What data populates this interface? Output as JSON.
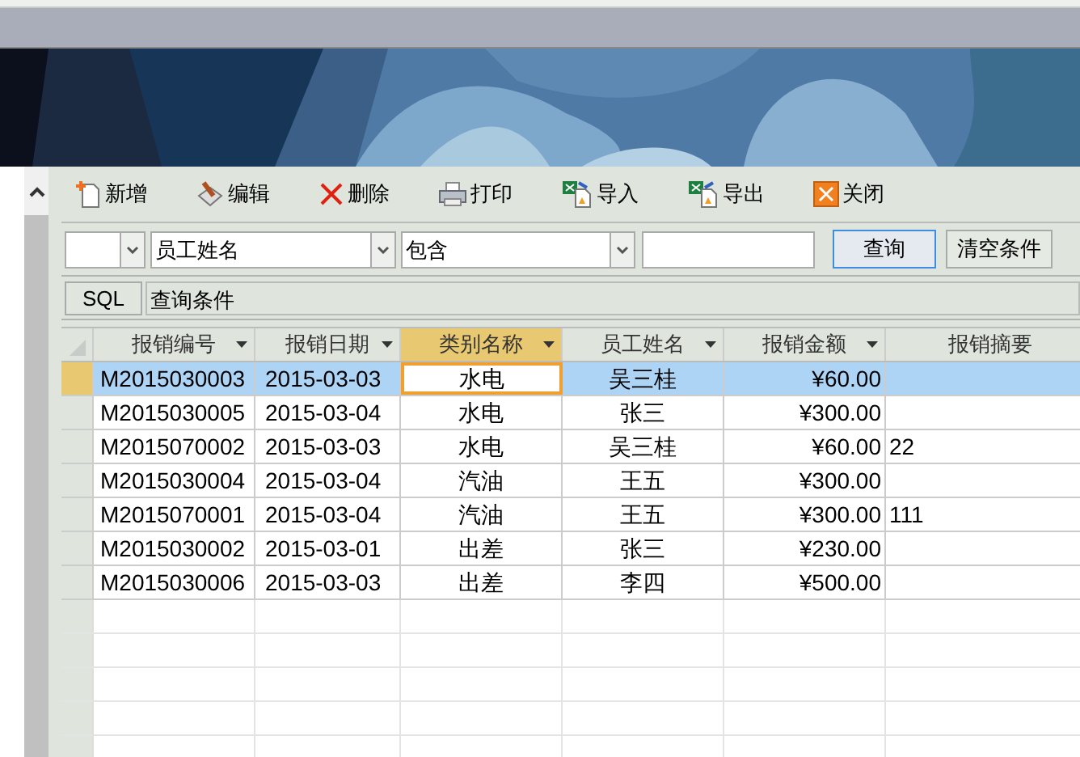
{
  "toolbar": [
    {
      "label": "新增",
      "kind": "add"
    },
    {
      "label": "编辑",
      "kind": "edit"
    },
    {
      "label": "删除",
      "kind": "delete"
    },
    {
      "label": "打印",
      "kind": "print"
    },
    {
      "label": "导入",
      "kind": "import"
    },
    {
      "label": "导出",
      "kind": "export"
    },
    {
      "label": "关闭",
      "kind": "close"
    }
  ],
  "filter": {
    "field": "员工姓名",
    "operator": "包含",
    "buttons": [
      "查询",
      "清空条件"
    ]
  },
  "sql": {
    "button": "SQL",
    "label": "查询条件"
  },
  "table": {
    "columns": [
      {
        "label": "报销编号",
        "selected": false
      },
      {
        "label": "报销日期",
        "selected": false
      },
      {
        "label": "类别名称",
        "selected": true
      },
      {
        "label": "员工姓名",
        "selected": false
      },
      {
        "label": "报销金额",
        "selected": false
      },
      {
        "label": "报销摘要",
        "selected": false
      }
    ],
    "rows": [
      {
        "selected": true,
        "cells": [
          "M2015030003",
          "2015-03-03",
          "水电",
          "吴三桂",
          "¥60.00",
          null
        ]
      },
      {
        "selected": false,
        "cells": [
          "M2015030005",
          "2015-03-04",
          "水电",
          "张三",
          "¥300.00",
          null
        ]
      },
      {
        "selected": false,
        "cells": [
          "M2015070002",
          "2015-03-03",
          "水电",
          "吴三桂",
          "¥60.00",
          "22"
        ]
      },
      {
        "selected": false,
        "cells": [
          "M2015030004",
          "2015-03-04",
          "汽油",
          "王五",
          "¥300.00",
          null
        ]
      },
      {
        "selected": false,
        "cells": [
          "M2015070001",
          "2015-03-04",
          "汽油",
          "王五",
          "¥300.00",
          "111"
        ]
      },
      {
        "selected": false,
        "cells": [
          "M2015030002",
          "2015-03-01",
          "出差",
          "张三",
          "¥230.00",
          null
        ]
      },
      {
        "selected": false,
        "cells": [
          "M2015030006",
          "2015-03-03",
          "出差",
          "李四",
          "¥500.00",
          null
        ]
      }
    ]
  }
}
